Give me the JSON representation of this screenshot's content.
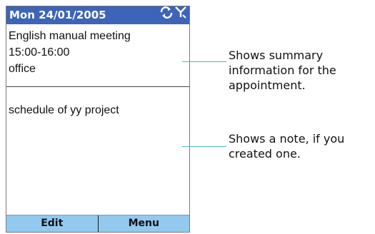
{
  "header": {
    "date": "Mon 24/01/2005",
    "icons": [
      "sync-icon",
      "signal-icon"
    ]
  },
  "appointment": {
    "title": "English manual meeting",
    "time": "15:00-16:00",
    "location": "office"
  },
  "note": {
    "text": "schedule of yy project"
  },
  "softkeys": {
    "left": "Edit",
    "right": "Menu"
  },
  "callouts": [
    {
      "lines": [
        "Shows summary",
        "information for the",
        "appointment."
      ]
    },
    {
      "lines": [
        "Shows a note, if you",
        "created one."
      ]
    }
  ],
  "colors": {
    "title_bar": "#3d64b8",
    "softkey_bar": "#92c9ee",
    "callout_line": "#4ab6cf"
  }
}
